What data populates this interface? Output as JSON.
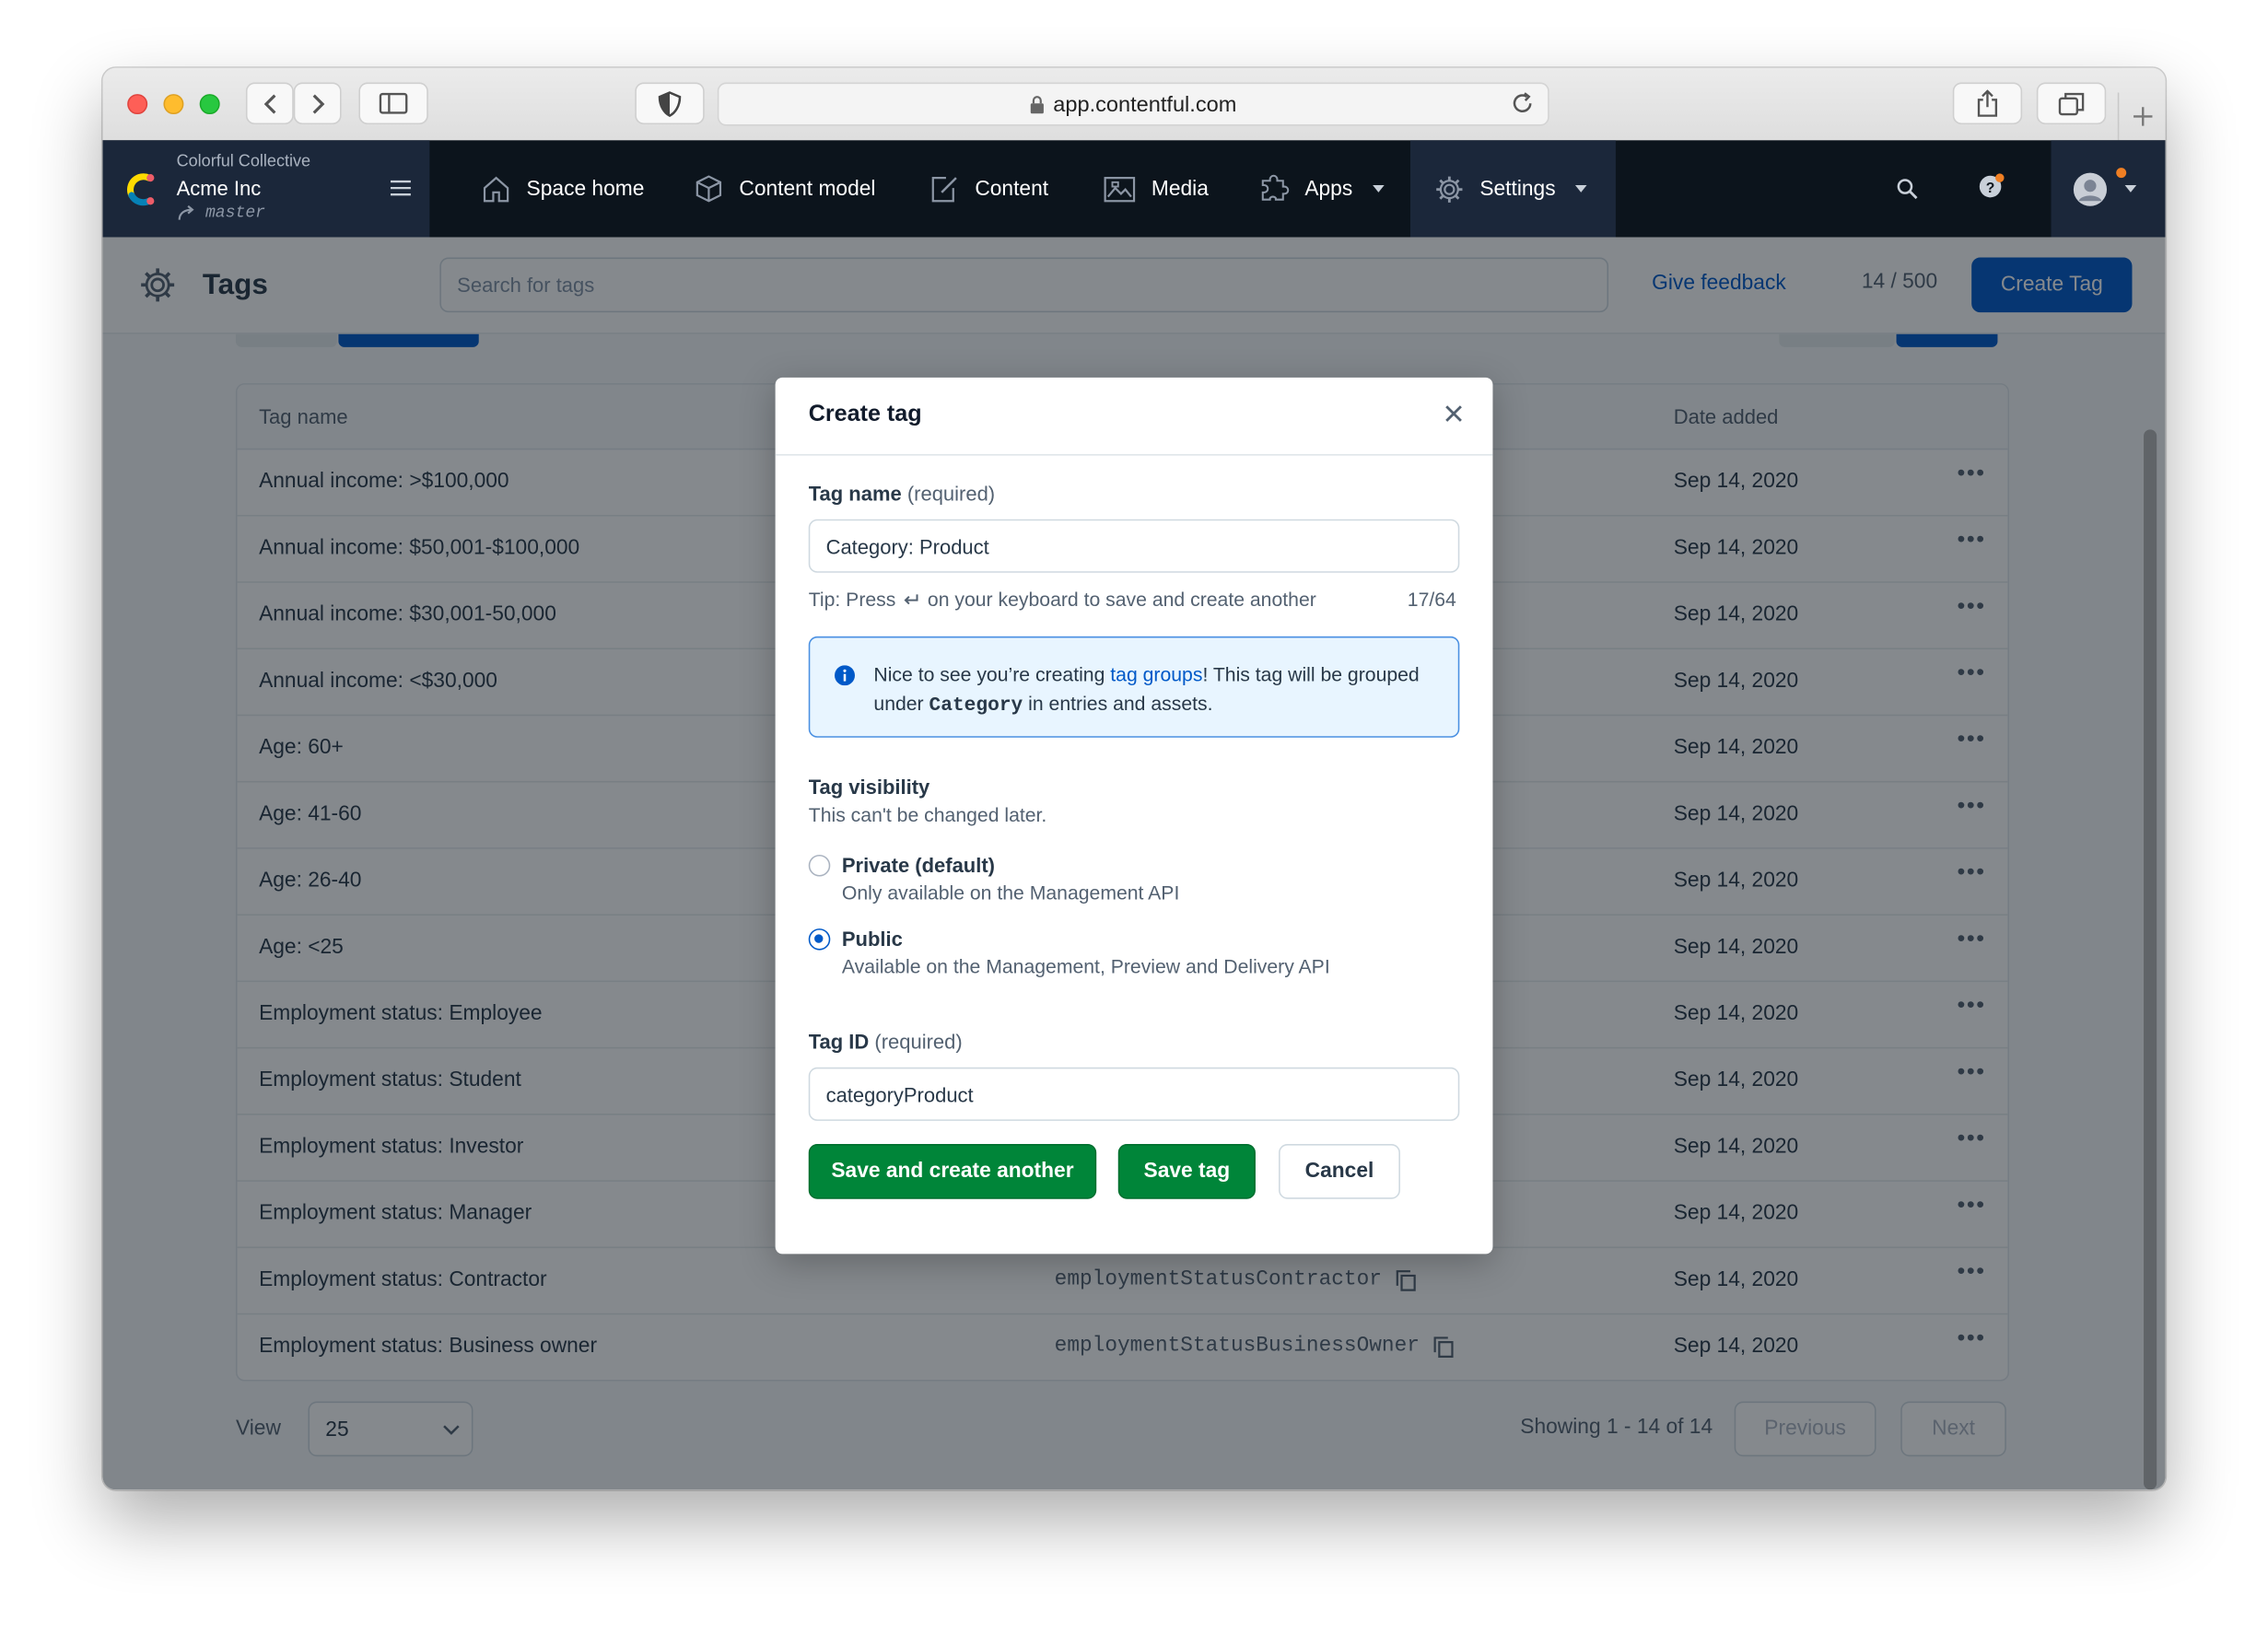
{
  "browser": {
    "url": "app.contentful.com"
  },
  "app": {
    "org": "Colorful Collective",
    "space": "Acme Inc",
    "environment": "master",
    "nav": [
      {
        "label": "Space home",
        "icon": "home-icon"
      },
      {
        "label": "Content model",
        "icon": "content-model-icon"
      },
      {
        "label": "Content",
        "icon": "content-icon"
      },
      {
        "label": "Media",
        "icon": "media-icon"
      },
      {
        "label": "Apps",
        "icon": "apps-icon"
      },
      {
        "label": "Settings",
        "icon": "settings-icon"
      }
    ],
    "brand_colors": {
      "nav_bg": "#0c141c",
      "primary": "#0059c8",
      "positive": "#008539"
    }
  },
  "header": {
    "title": "Tags",
    "search_placeholder": "Search for tags",
    "feedback_label": "Give feedback",
    "count": "14 / 500",
    "create_label": "Create Tag"
  },
  "table": {
    "columns": [
      "Tag name",
      "Date added"
    ],
    "rows": [
      {
        "name": "Annual income: >$100,000",
        "id": "",
        "date": "Sep 14, 2020"
      },
      {
        "name": "Annual income: $50,001-$100,000",
        "id": "",
        "date": "Sep 14, 2020"
      },
      {
        "name": "Annual income: $30,001-50,000",
        "id": "",
        "date": "Sep 14, 2020"
      },
      {
        "name": "Annual income: <$30,000",
        "id": "",
        "date": "Sep 14, 2020"
      },
      {
        "name": "Age: 60+",
        "id": "",
        "date": "Sep 14, 2020"
      },
      {
        "name": "Age: 41-60",
        "id": "",
        "date": "Sep 14, 2020"
      },
      {
        "name": "Age: 26-40",
        "id": "",
        "date": "Sep 14, 2020"
      },
      {
        "name": "Age: <25",
        "id": "",
        "date": "Sep 14, 2020"
      },
      {
        "name": "Employment status: Employee",
        "id": "",
        "date": "Sep 14, 2020"
      },
      {
        "name": "Employment status: Student",
        "id": "",
        "date": "Sep 14, 2020"
      },
      {
        "name": "Employment status: Investor",
        "id": "",
        "date": "Sep 14, 2020"
      },
      {
        "name": "Employment status: Manager",
        "id": "",
        "date": "Sep 14, 2020"
      },
      {
        "name": "Employment status: Contractor",
        "id": "employmentStatusContractor",
        "date": "Sep 14, 2020"
      },
      {
        "name": "Employment status: Business owner",
        "id": "employmentStatusBusinessOwner",
        "date": "Sep 14, 2020"
      }
    ],
    "footer": {
      "view_label": "View",
      "page_size": "25",
      "showing": "Showing 1 - 14 of 14",
      "previous": "Previous",
      "next": "Next"
    }
  },
  "modal": {
    "title": "Create tag",
    "name_label": "Tag name",
    "required": "(required)",
    "name_value": "Category: Product",
    "tip_prefix": "Tip: Press",
    "tip_suffix": "on your keyboard to save and create another",
    "char_count": "17/64",
    "note_part1": "Nice to see you’re creating ",
    "note_link": "tag groups",
    "note_part2": "! This tag will be grouped under ",
    "note_group": "Category",
    "note_part3": " in entries and assets.",
    "visibility_label": "Tag visibility",
    "visibility_hint": "This can't be changed later.",
    "options": [
      {
        "label": "Private (default)",
        "desc": "Only available on the Management API",
        "selected": false
      },
      {
        "label": "Public",
        "desc": "Available on the Management, Preview and Delivery API",
        "selected": true
      }
    ],
    "id_label": "Tag ID",
    "id_value": "categoryProduct",
    "save_another": "Save and create another",
    "save": "Save tag",
    "cancel": "Cancel"
  }
}
